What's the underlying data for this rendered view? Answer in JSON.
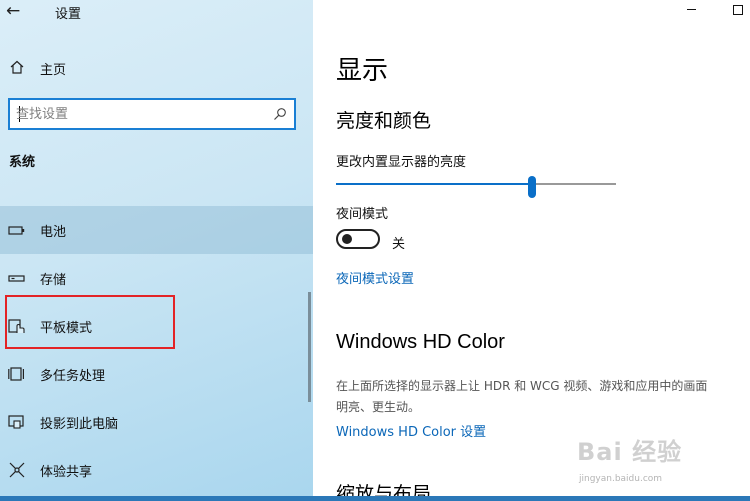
{
  "app": {
    "title": "设置",
    "back_glyph": "←"
  },
  "window_controls": {
    "minimize": "minimize",
    "maximize": "maximize"
  },
  "sidebar": {
    "home_label": "主页",
    "search_placeholder": "查找设置",
    "section_label": "系统",
    "items": [
      {
        "label": "电池",
        "icon": "battery-icon",
        "selected": true
      },
      {
        "label": "存储",
        "icon": "storage-icon",
        "selected": false
      },
      {
        "label": "平板模式",
        "icon": "tablet-mode-icon",
        "selected": false
      },
      {
        "label": "多任务处理",
        "icon": "multitasking-icon",
        "selected": false
      },
      {
        "label": "投影到此电脑",
        "icon": "project-icon",
        "selected": false
      },
      {
        "label": "体验共享",
        "icon": "shared-experiences-icon",
        "selected": false
      }
    ]
  },
  "main": {
    "title": "显示",
    "brightness_heading": "亮度和颜色",
    "brightness_label": "更改内置显示器的亮度",
    "brightness_value": 0.7,
    "night_light_label": "夜间模式",
    "night_light_state": "关",
    "night_light_link": "夜间模式设置",
    "hd_heading": "Windows HD Color",
    "hd_desc_line1": "在上面所选择的显示器上让 HDR 和 WCG 视频、游戏和应用中的画面",
    "hd_desc_line2": "明亮、更生动。",
    "hd_link": "Windows HD Color 设置",
    "scale_heading": "缩放与布局"
  },
  "watermark": {
    "text": "Bai 经验",
    "sub": "jingyan.baidu.com"
  },
  "colors": {
    "accent": "#0a6fc8",
    "highlight": "#e32326",
    "link": "#0b67b8"
  }
}
